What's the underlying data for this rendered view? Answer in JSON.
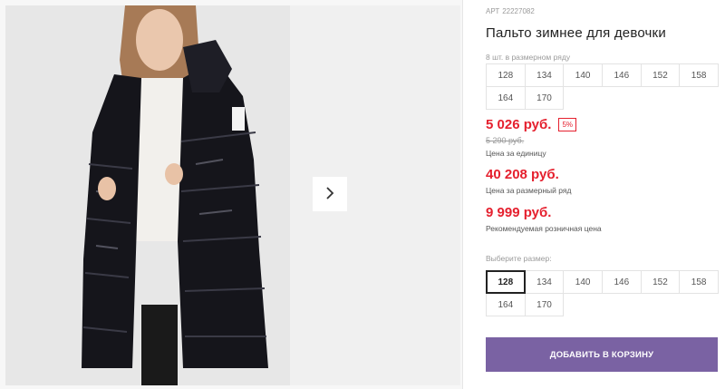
{
  "product": {
    "article_label": "АРТ",
    "article_value": "22227082",
    "title": "Пальто зимнее для девочки"
  },
  "size_range": {
    "hint": "8 шт. в размерном ряду",
    "sizes": [
      "128",
      "134",
      "140",
      "146",
      "152",
      "158",
      "164",
      "170"
    ]
  },
  "prices": {
    "unit_price": "5 026 руб.",
    "discount_badge": "5%",
    "old_price": "5 290 руб.",
    "unit_caption": "Цена за единицу",
    "range_price": "40 208 руб.",
    "range_caption": "Цена за размерный ряд",
    "retail_price": "9 999 руб.",
    "retail_caption": "Рекомендуемая розничная цена"
  },
  "size_select": {
    "label": "Выберите размер:",
    "selected": "128",
    "sizes": [
      "128",
      "134",
      "140",
      "146",
      "152",
      "158",
      "164",
      "170"
    ]
  },
  "cart": {
    "add_label": "ДОБАВИТЬ В КОРЗИНУ"
  },
  "colors": {
    "accent": "#7a62a3",
    "price": "#e5202e",
    "coat": "#15151b"
  },
  "icons": {
    "next": "chevron-right-icon"
  }
}
